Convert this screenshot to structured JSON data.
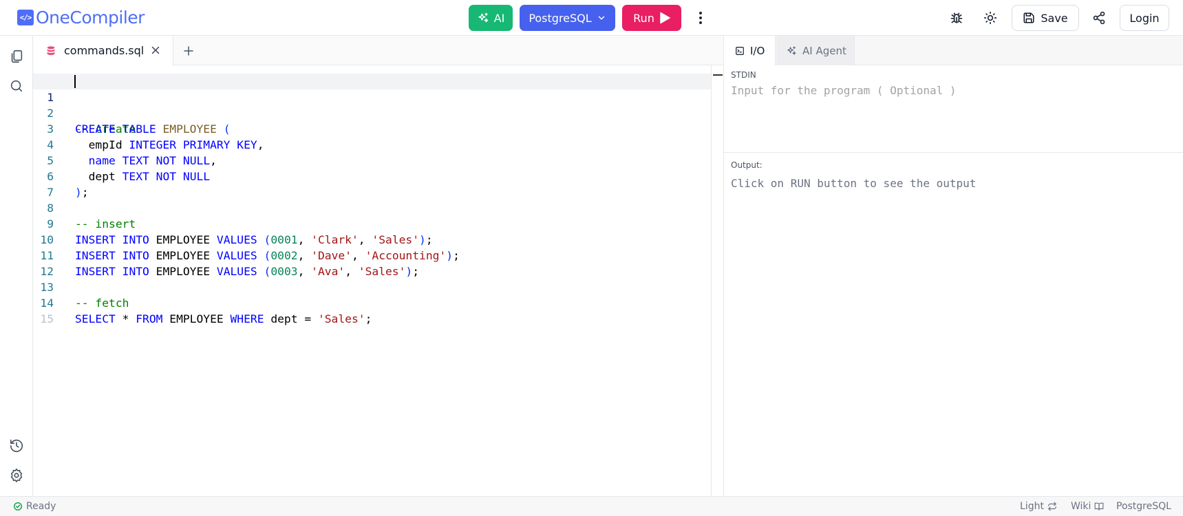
{
  "header": {
    "logo_mark": "</>",
    "logo_text": "OneCompiler",
    "ai_label": "AI",
    "language_label": "PostgreSQL",
    "run_label": "Run",
    "save_label": "Save",
    "login_label": "Login",
    "icons": [
      "sparkle-icon",
      "chevron-down-icon",
      "play-icon",
      "more-vertical-icon",
      "bug-icon",
      "sun-icon",
      "save-icon",
      "share-icon"
    ]
  },
  "sidebar": {
    "icons": [
      "files-icon",
      "search-icon",
      "history-icon",
      "settings-icon"
    ]
  },
  "editor": {
    "tab": {
      "filename": "commands.sql",
      "icon": "database-icon"
    },
    "add_tab_icon": "plus-icon",
    "lines": [
      {
        "num": "1",
        "text": "-- create"
      },
      {
        "num": "2",
        "text": "CREATE TABLE EMPLOYEE ("
      },
      {
        "num": "3",
        "text": "  empId INTEGER PRIMARY KEY,"
      },
      {
        "num": "4",
        "text": "  name TEXT NOT NULL,"
      },
      {
        "num": "5",
        "text": "  dept TEXT NOT NULL"
      },
      {
        "num": "6",
        "text": ");"
      },
      {
        "num": "7",
        "text": ""
      },
      {
        "num": "8",
        "text": "-- insert"
      },
      {
        "num": "9",
        "text": "INSERT INTO EMPLOYEE VALUES (0001, 'Clark', 'Sales');"
      },
      {
        "num": "10",
        "text": "INSERT INTO EMPLOYEE VALUES (0002, 'Dave', 'Accounting');"
      },
      {
        "num": "11",
        "text": "INSERT INTO EMPLOYEE VALUES (0003, 'Ava', 'Sales');"
      },
      {
        "num": "12",
        "text": ""
      },
      {
        "num": "13",
        "text": "-- fetch"
      },
      {
        "num": "14",
        "text": "SELECT * FROM EMPLOYEE WHERE dept = 'Sales';"
      },
      {
        "num": "15",
        "text": ""
      }
    ]
  },
  "io": {
    "tab_io": "I/O",
    "tab_agent": "AI Agent",
    "stdin_label": "STDIN",
    "stdin_placeholder": "Input for the program ( Optional )",
    "output_label": "Output:",
    "output_text": "Click on RUN button to see the output"
  },
  "status": {
    "ready": "Ready",
    "theme": "Light",
    "wiki": "Wiki",
    "language": "PostgreSQL"
  },
  "colors": {
    "ai_button": "#16b873",
    "language_button": "#4661ee",
    "run_button": "#e91e63",
    "brand": "#4f6ef7",
    "keyword": "#0000ff",
    "comment": "#008000",
    "string": "#a31515",
    "number": "#098658"
  }
}
